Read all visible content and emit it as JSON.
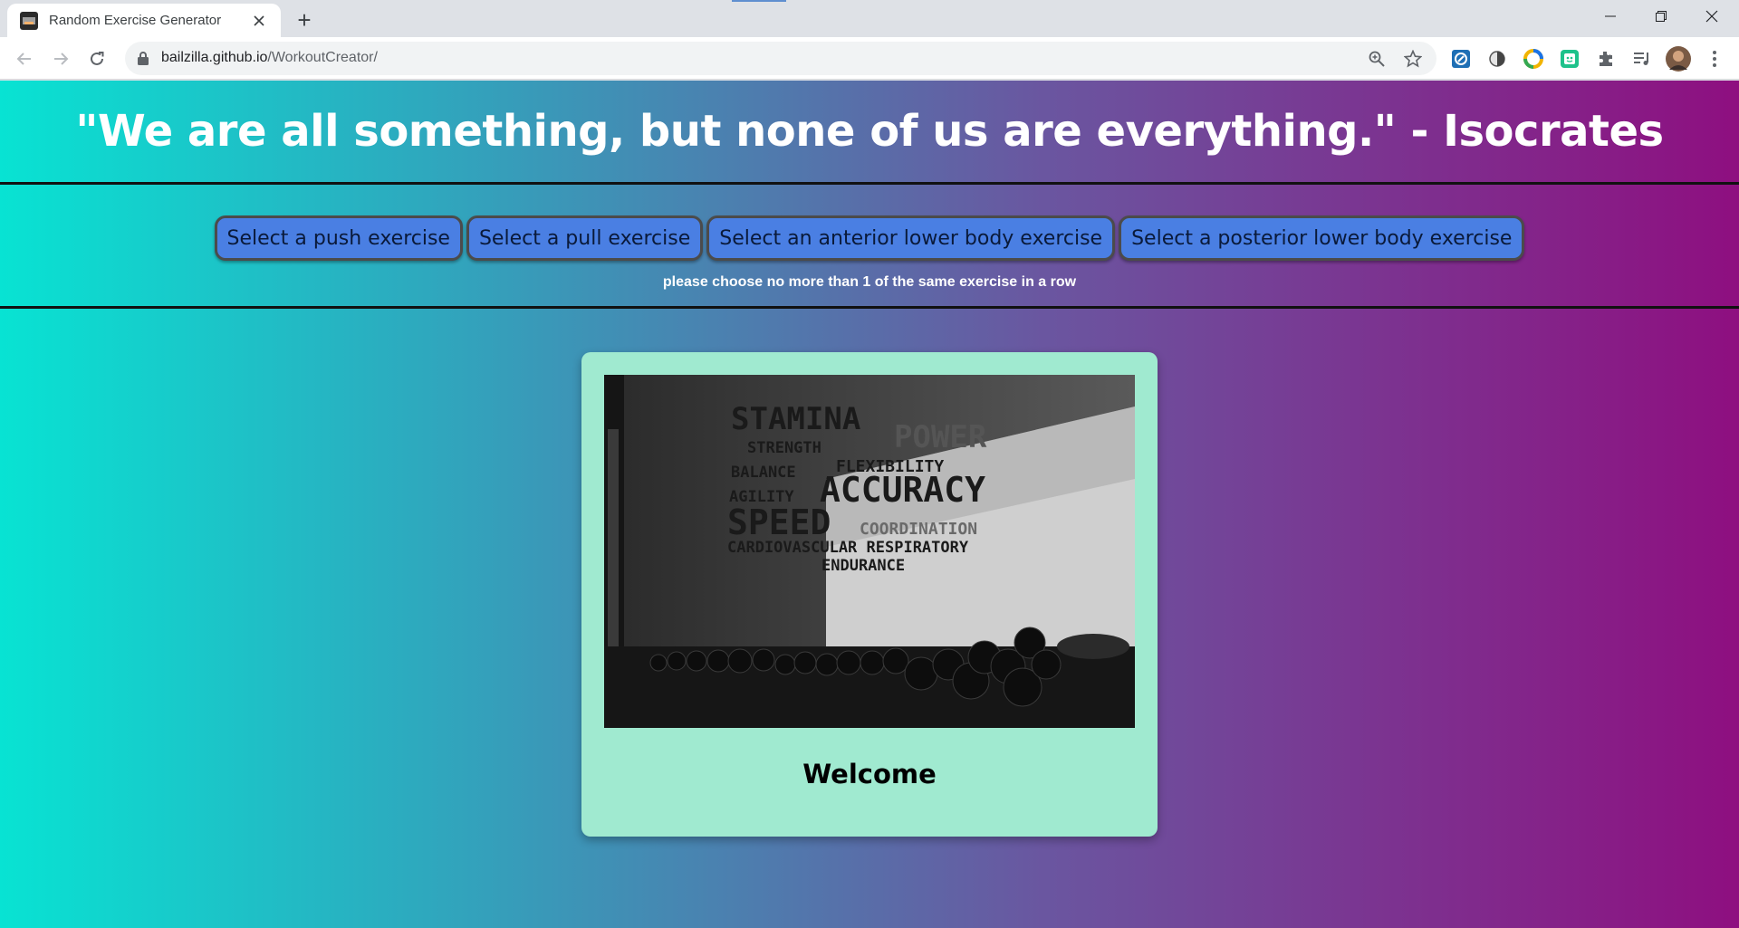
{
  "browser": {
    "tab_title": "Random Exercise Generator",
    "new_tab_symbol": "+",
    "close_symbol": "✕",
    "url_domain": "bailzilla.github.io",
    "url_path": "/WorkoutCreator/"
  },
  "header": {
    "quote": "\"We are all something, but none of us are everything.\" - Isocrates"
  },
  "controls": {
    "buttons": [
      "Select a push exercise",
      "Select a pull exercise",
      "Select an anterior lower body exercise",
      "Select a posterior lower body exercise"
    ],
    "note": "please choose no more than 1 of the same exercise in a row"
  },
  "card": {
    "title": "Welcome",
    "image_words": {
      "stamina": "STAMINA",
      "power": "POWER",
      "strength": "STRENGTH",
      "flexibility": "FLEXIBILITY",
      "balance": "BALANCE",
      "accuracy": "ACCURACY",
      "agility": "AGILITY",
      "speed": "SPEED",
      "coordination": "COORDINATION",
      "cardio": "CARDIOVASCULAR RESPIRATORY",
      "endurance": "ENDURANCE"
    }
  },
  "icons": [
    "back-icon",
    "forward-icon",
    "reload-icon",
    "lock-icon",
    "zoom-icon",
    "star-icon",
    "extensions-icon",
    "media-icon",
    "profile-avatar",
    "menu-icon"
  ],
  "colors": {
    "gradient_left": "#08e3d3",
    "gradient_right": "#8e0f80",
    "button": "#4a7fe3",
    "card": "#a0ead0"
  }
}
